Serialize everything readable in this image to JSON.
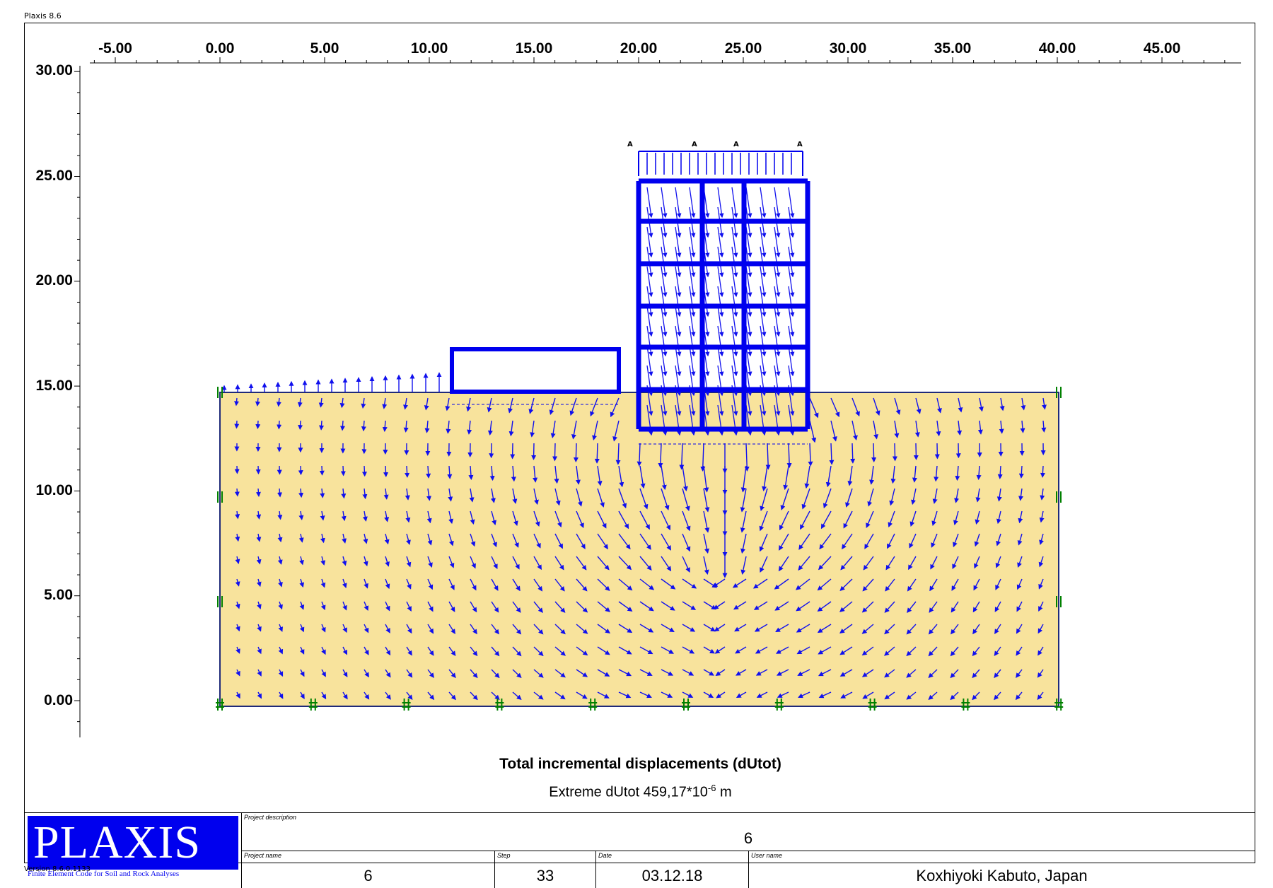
{
  "app": {
    "title": "Plaxis 8.6",
    "version": "Version 8.6.0.1133"
  },
  "plot": {
    "x_ticks": [
      "-5.00",
      "0.00",
      "5.00",
      "10.00",
      "15.00",
      "20.00",
      "25.00",
      "30.00",
      "35.00",
      "40.00",
      "45.00"
    ],
    "y_ticks": [
      "30.00",
      "25.00",
      "20.00",
      "15.00",
      "10.00",
      "5.00",
      "0.00"
    ],
    "load_labels": [
      "A",
      "A",
      "A",
      "A"
    ],
    "title": "Total incremental displacements (dUtot)",
    "extreme_prefix": "Extreme dUtot 459,17*10",
    "extreme_exp": "-6",
    "extreme_unit": "m",
    "colors": {
      "soil": "#f8e39c",
      "structure": "#0000ee",
      "vectors": "#1010ee",
      "fixity": "#008000"
    }
  },
  "title_block": {
    "logo_text": "PLAXIS",
    "logo_tagline": "Finite Element Code for Soil and Rock Analyses",
    "project_description_label": "Project description",
    "project_description": "6",
    "project_name_label": "Project name",
    "project_name": "6",
    "step_label": "Step",
    "step": "33",
    "date_label": "Date",
    "date": "03.12.18",
    "user_name_label": "User name",
    "user_name": "Koxhiyoki Kabuto, Japan"
  }
}
